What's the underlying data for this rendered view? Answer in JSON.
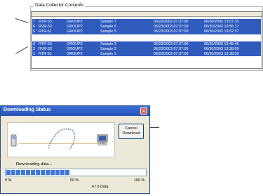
{
  "data_collector": {
    "group_title": "Data Collector Contents",
    "top_block_rows": [
      {
        "no": "7",
        "serial": "RTR-53",
        "group": "GROUP2",
        "name": "Sample 7",
        "date1": "06/23/2003 07:37:00",
        "date2": "06/30/2003 13:57:15"
      },
      {
        "no": "6",
        "serial": "RVR-52",
        "group": "GROUP2",
        "name": "Sample 6",
        "date1": "06/23/2003 07:37:00",
        "date2": "06/30/2003 13:56:17"
      },
      {
        "no": "5",
        "serial": "RTR-51",
        "group": "GROUP2",
        "name": "Sample 5",
        "date1": "06/23/2003 07:37:00",
        "date2": "06/30/2003 13:52:37"
      }
    ],
    "bottom_block_rows": [
      {
        "no": "3",
        "serial": "RTR-53",
        "group": "GROUP2",
        "name": "Sample 3",
        "date1": "06/23/2003 07:37:00",
        "date2": "06/30/2003 13:45:46"
      },
      {
        "no": "2",
        "serial": "RVR-52",
        "group": "GROUP2",
        "name": "Sample 2",
        "date1": "06/23/2003 07:37:00",
        "date2": "06/30/2003 13:38:09"
      },
      {
        "no": "1",
        "serial": "RTR-51",
        "group": "GROUP2",
        "name": "Sample 1",
        "date1": "06/23/2003 07:37:00",
        "date2": "06/30/2003 13:38:09"
      }
    ]
  },
  "dialog": {
    "title": "Downloading Status",
    "close_glyph": "✕",
    "cancel_line1": "Cancel",
    "cancel_line2": "Download",
    "status_text": "Downloading data...",
    "progress_value": 0.45,
    "scale_0": "0 %",
    "scale_50": "50 %",
    "scale_100": "100 %",
    "count_text": "4 / 6 Data"
  },
  "colors": {
    "selection": "#2f5bbd",
    "progress": "#3e78d8"
  }
}
